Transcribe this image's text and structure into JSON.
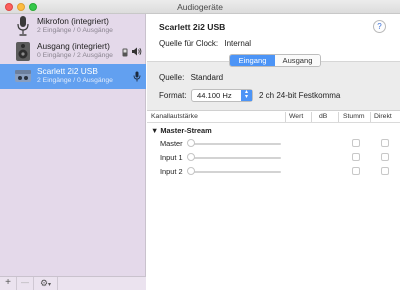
{
  "window": {
    "title": "Audiogeräte"
  },
  "sidebar": {
    "devices": [
      {
        "name": "Mikrofon (integriert)",
        "sub": "2 Eingänge / 0 Ausgänge",
        "icon": "microphone-icon",
        "selected": false
      },
      {
        "name": "Ausgang (integriert)",
        "sub": "0 Eingänge / 2 Ausgänge",
        "icon": "speaker-icon",
        "selected": false
      },
      {
        "name": "Scarlett 2i2 USB",
        "sub": "2 Eingänge / 0 Ausgänge",
        "icon": "usb-audio-interface-icon",
        "selected": true
      }
    ],
    "footer": {
      "add_label": "+",
      "remove_label": "—",
      "action_label": "⚙"
    }
  },
  "detail": {
    "device_title": "Scarlett 2i2 USB",
    "help_label": "?",
    "clock_label": "Quelle für Clock:",
    "clock_value": "Internal",
    "tabs": [
      {
        "label": "Eingang",
        "active": true
      },
      {
        "label": "Ausgang",
        "active": false
      }
    ],
    "source_label": "Quelle:",
    "source_value": "Standard",
    "format_label": "Format:",
    "format_value": "44.100 Hz",
    "format_desc": "2 ch 24-bit Festkomma"
  },
  "table": {
    "columns": [
      "Kanallautstärke",
      "Wert",
      "dB",
      "Stumm",
      "Direkt"
    ],
    "group": "▼ Master-Stream",
    "rows": [
      {
        "label": "Master"
      },
      {
        "label": "Input 1"
      },
      {
        "label": "Input 2"
      }
    ]
  },
  "colors": {
    "accent": "#4c94f6",
    "sidebar_bg": "#e4d9ea",
    "selection": "#62a0f0"
  }
}
